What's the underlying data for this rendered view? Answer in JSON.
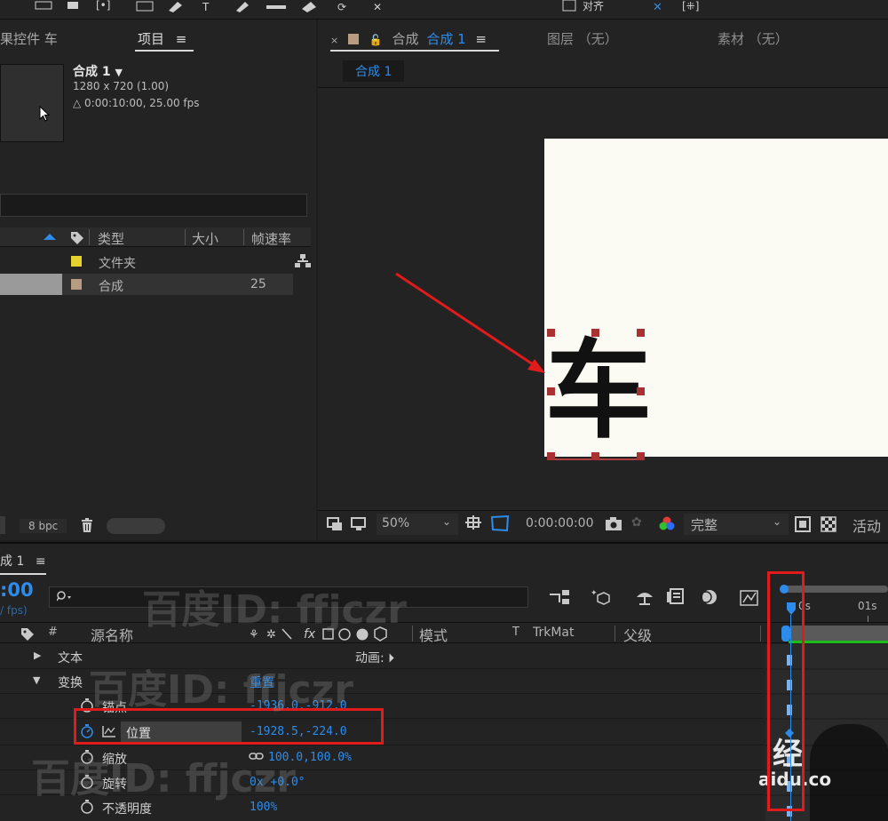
{
  "project": {
    "tab_effects": "果控件 车",
    "tab_project": "项目",
    "menu_glyph": "≡",
    "comp_name": "合成 1",
    "comp_dims": "1280 x 720 (1.00)",
    "comp_dur": "△ 0:00:10:00, 25.00 fps",
    "col_type": "类型",
    "col_size": "大小",
    "col_fps": "帧速率",
    "items": [
      {
        "type": "文件夹",
        "size": "",
        "swatch": "#e6d22e"
      },
      {
        "type": "合成",
        "size": "25",
        "swatch": "#b89c82"
      }
    ],
    "bpc": "8 bpc"
  },
  "viewer": {
    "tab_prefix": "合成",
    "tab_name": "合成 1",
    "tab_layer": "图层 （无）",
    "tab_footage": "素材 （无）",
    "crumb": "合成 1",
    "canvas_text": "车",
    "zoom": "50%",
    "timecode": "0:00:00:00",
    "resolution": "完整",
    "active_camera": "活动"
  },
  "timeline": {
    "title": "成 1",
    "timecode": ":00",
    "fps": "/ fps)",
    "col_source": "源名称",
    "col_mode": "模式",
    "col_trkmat": "TrkMat",
    "col_parent": "父级",
    "ruler_0": "0s",
    "ruler_1": "01s",
    "rows": {
      "text": "文本",
      "animate": "动画:",
      "transform": "变换",
      "reset": "重置",
      "anchor": "锚点",
      "anchor_val": "-1936.0,-912.0",
      "position": "位置",
      "position_val": "-1928.5,-224.0",
      "scale": "缩放",
      "scale_val": "100.0,100.0%",
      "rotation": "旋转",
      "rotation_val": "0x +0.0°",
      "opacity": "不透明度",
      "opacity_val": "100%"
    }
  },
  "watermark": {
    "text": "百度ID: ffjczr",
    "logo": "经",
    "domain": "aidu.co"
  },
  "colors": {
    "accent": "#2d8ceb",
    "highlight_box": "#e01b1b",
    "canvas": "#fbfbf3",
    "keyframe_green": "#1bbd1b"
  }
}
